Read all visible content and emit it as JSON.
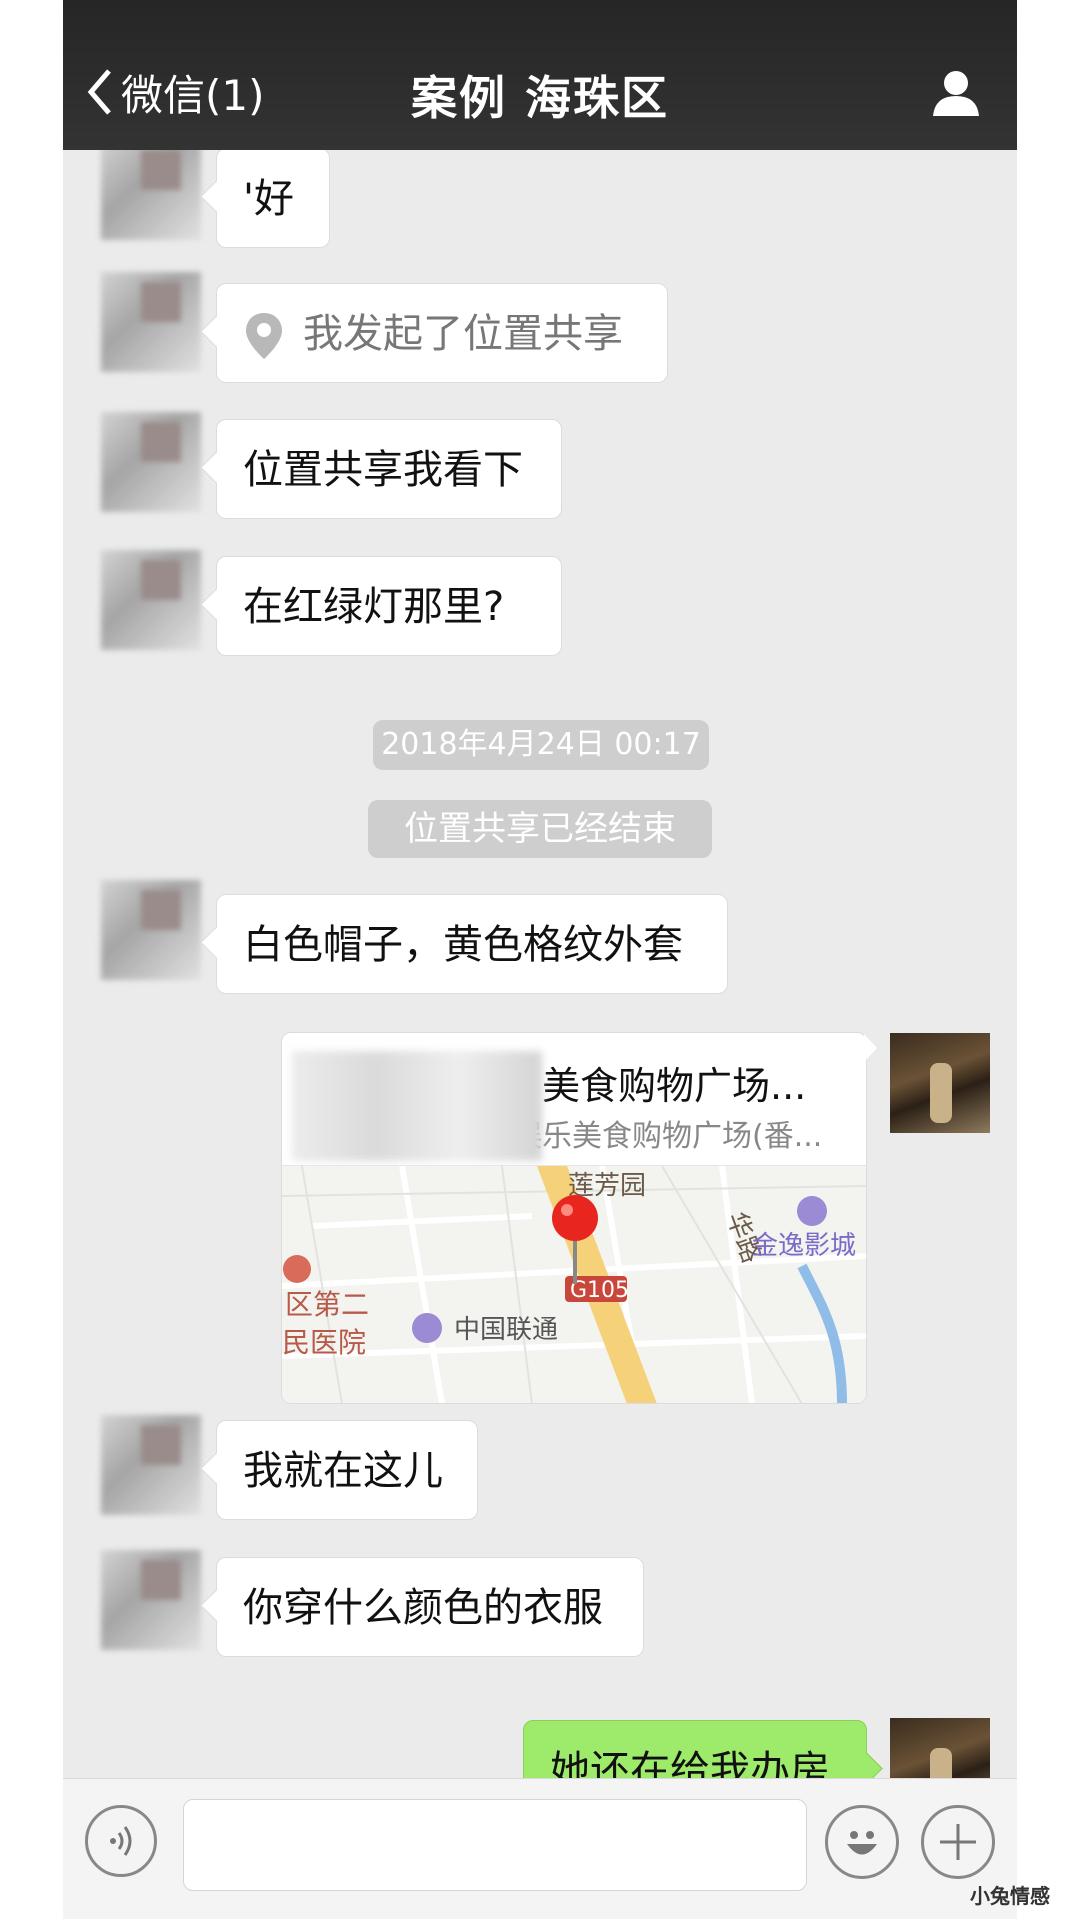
{
  "header": {
    "back_label": "微信(1)",
    "title": "案例 海珠区"
  },
  "messages": [
    {
      "text": "'好"
    },
    {
      "text": "我发起了位置共享"
    },
    {
      "text": "位置共享我看下"
    },
    {
      "text": "在红绿灯那里?"
    },
    {
      "text": "白色帽子，黄色格纹外套"
    },
    {
      "text": "我就在这儿"
    },
    {
      "text": "你穿什么颜色的衣服"
    },
    {
      "text": "她还在给我办房"
    }
  ],
  "system": {
    "timestamp": "2018年4月24日 00:17",
    "share_ended": "位置共享已经结束"
  },
  "location_card": {
    "title": "美食购物广场...",
    "subtitle": "娱乐美食购物广场(番...",
    "map_labels": [
      "莲芳园",
      "华路",
      "金逸影城",
      "区第二",
      "民医院",
      "中国联通",
      "G105"
    ]
  },
  "watermark": "小兔情感",
  "colors": {
    "nav_bg": "#2e2e2e",
    "chat_bg": "#ebebeb",
    "green_bubble": "#9eea6a"
  },
  "icons": [
    "back-chevron-icon",
    "person-icon",
    "location-pin-icon",
    "voice-icon",
    "emoji-icon",
    "plus-icon"
  ]
}
